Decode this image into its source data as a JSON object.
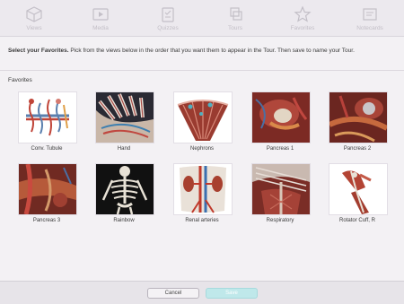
{
  "tabs": [
    {
      "label": "Views",
      "icon": "cube-icon"
    },
    {
      "label": "Media",
      "icon": "play-icon"
    },
    {
      "label": "Quizzes",
      "icon": "clipboard-icon"
    },
    {
      "label": "Tours",
      "icon": "stack-icon"
    },
    {
      "label": "Favorites",
      "icon": "star-icon"
    },
    {
      "label": "Notecards",
      "icon": "notecard-icon"
    }
  ],
  "instructions": {
    "bold": "Select your Favorites.",
    "text": " Pick from the views below in the order that you want them to appear in the Tour. Then save to name your Tour."
  },
  "section_title": "Favorites",
  "favorites": [
    {
      "label": "Conv. Tubule"
    },
    {
      "label": "Hand"
    },
    {
      "label": "Nephrons"
    },
    {
      "label": "Pancreas 1"
    },
    {
      "label": "Pancreas 2"
    },
    {
      "label": "Pancreas 3"
    },
    {
      "label": "Rainbow"
    },
    {
      "label": "Renal arteries"
    },
    {
      "label": "Respiratory"
    },
    {
      "label": "Rotator Cuff, R"
    }
  ],
  "footer": {
    "cancel_label": "Cancel",
    "save_label": "Save"
  },
  "colors": {
    "accent": "#bfe8ea",
    "tab_inactive": "#c3bfc7"
  }
}
